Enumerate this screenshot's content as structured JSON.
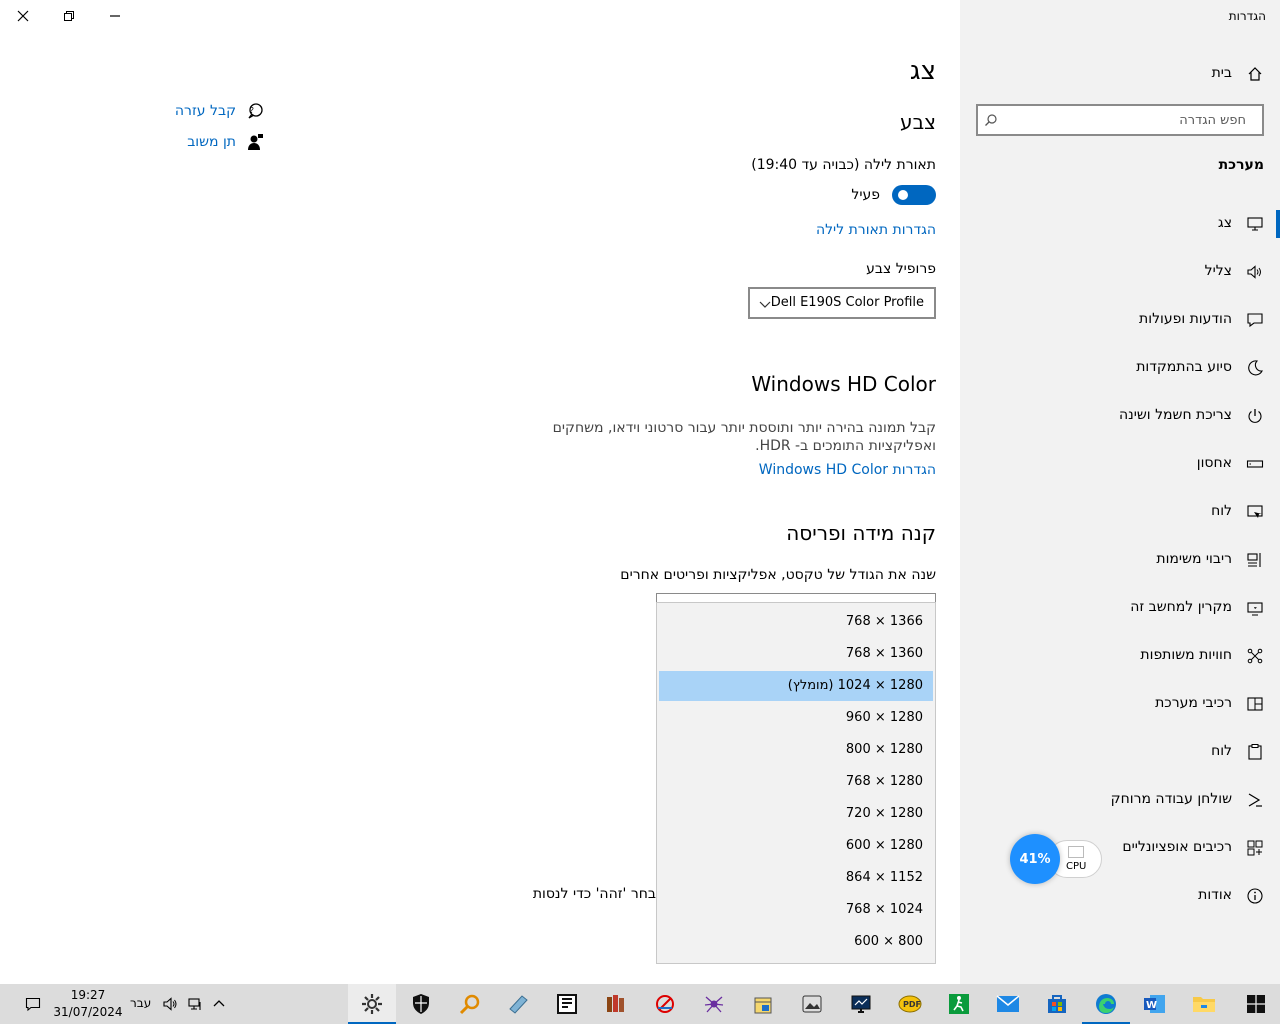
{
  "window": {
    "title": "הגדרות",
    "close_icon": "close-icon",
    "restore_icon": "restore-icon",
    "minimize_icon": "minimize-icon"
  },
  "sidebar": {
    "home_label": "בית",
    "search_placeholder": "חפש הגדרה",
    "section_title": "מערכת",
    "items": [
      {
        "label": "צג",
        "icon": "monitor-icon",
        "active": true
      },
      {
        "label": "צליל",
        "icon": "speaker-icon"
      },
      {
        "label": "הודעות ופעולות",
        "icon": "notification-icon"
      },
      {
        "label": "סיוע בהתמקדות",
        "icon": "moon-icon"
      },
      {
        "label": "צריכת חשמל ושינה",
        "icon": "power-icon"
      },
      {
        "label": "אחסון",
        "icon": "storage-icon"
      },
      {
        "label": "לוח",
        "icon": "tablet-icon"
      },
      {
        "label": "ריבוי משימות",
        "icon": "multitasking-icon"
      },
      {
        "label": "מקרין למחשב זה",
        "icon": "projecting-icon"
      },
      {
        "label": "חוויות משותפות",
        "icon": "shared-icon"
      },
      {
        "label": "רכיבי מערכת",
        "icon": "components-icon"
      },
      {
        "label": "לוח",
        "icon": "clipboard-icon"
      },
      {
        "label": "שולחן עבודה מרוחק",
        "icon": "remote-icon"
      },
      {
        "label": "רכיבים אופציונליים",
        "icon": "optional-icon"
      },
      {
        "label": "אודות",
        "icon": "info-icon"
      }
    ]
  },
  "main": {
    "page_title": "צג",
    "color_heading": "צבע",
    "night_light_label": "תאורת לילה (כבויה עד 19:40)",
    "night_light_state": "פעיל",
    "night_light_settings_link": "הגדרות תאורת לילה",
    "color_profile_label": "פרופיל צבע",
    "color_profile_value": "Dell E190S Color Profile",
    "hdr_heading": "Windows HD Color",
    "hdr_description": "קבל תמונה בהירה יותר ותוססת יותר עבור סרטוני וידאו, משחקים ואפליקציות התומכים ב- HDR.",
    "hdr_settings_link": "Windows HD Color הגדרות",
    "scale_heading": "קנה מידה ופריסה",
    "scale_label": "שנה את הגודל של טקסט, אפליקציות ופריטים אחרים",
    "keep_hint": "בחר 'זהה' כדי לנסות",
    "resolution_options": [
      "1366 × 768",
      "1360 × 768",
      "1280 × 1024 (מומלץ)",
      "1280 × 960",
      "1280 × 800",
      "1280 × 768",
      "1280 × 720",
      "1280 × 600",
      "1152 × 864",
      "1024 × 768",
      "800 × 600"
    ],
    "selected_resolution": "1280 × 1024 (מומלץ)"
  },
  "help": {
    "get_help": "קבל עזרה",
    "give_feedback": "תן משוב"
  },
  "cpu_widget": {
    "percent": "41%",
    "label": "CPU"
  },
  "taskbar": {
    "time": "19:27",
    "date": "31/07/2024",
    "language": "עבר",
    "apps": [
      "start-icon",
      "file-explorer-icon",
      "word-icon",
      "edge-icon",
      "store-icon",
      "mail-icon",
      "app-icon",
      "pdf-icon",
      "monitor-app-icon",
      "app-icon",
      "app-icon",
      "app-icon",
      "app-icon",
      "app-icon",
      "app-icon",
      "app-icon",
      "search-tool-icon",
      "security-icon",
      "settings-icon"
    ],
    "colors": {
      "accent": "#0067c0",
      "selection": "#a9d3f7",
      "sidebar_bg": "#f2f2f2",
      "taskbar_bg": "#dcdcdc"
    }
  }
}
